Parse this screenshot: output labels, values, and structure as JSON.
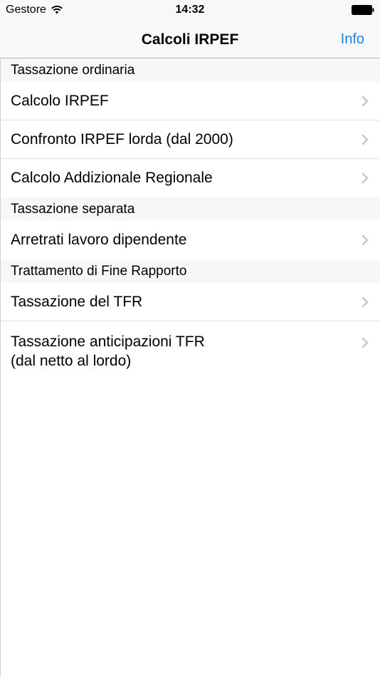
{
  "status_bar": {
    "carrier": "Gestore",
    "time": "14:32"
  },
  "nav_bar": {
    "title": "Calcoli IRPEF",
    "info_label": "Info",
    "accent_color": "#1a84e4"
  },
  "sections": [
    {
      "header": "Tassazione ordinaria",
      "rows": [
        {
          "line1": "Calcolo IRPEF"
        },
        {
          "line1": "Confronto IRPEF lorda (dal 2000)"
        },
        {
          "line1": "Calcolo Addizionale Regionale"
        }
      ]
    },
    {
      "header": "Tassazione separata",
      "rows": [
        {
          "line1": "Arretrati lavoro dipendente"
        }
      ]
    },
    {
      "header": "Trattamento di Fine Rapporto",
      "rows": [
        {
          "line1": "Tassazione del TFR"
        },
        {
          "line1": "Tassazione anticipazioni TFR",
          "line2": "(dal netto al lordo)"
        }
      ]
    }
  ],
  "icons": {
    "wifi": "wifi-icon",
    "battery": "battery-icon",
    "chevron": "chevron-right-icon"
  }
}
